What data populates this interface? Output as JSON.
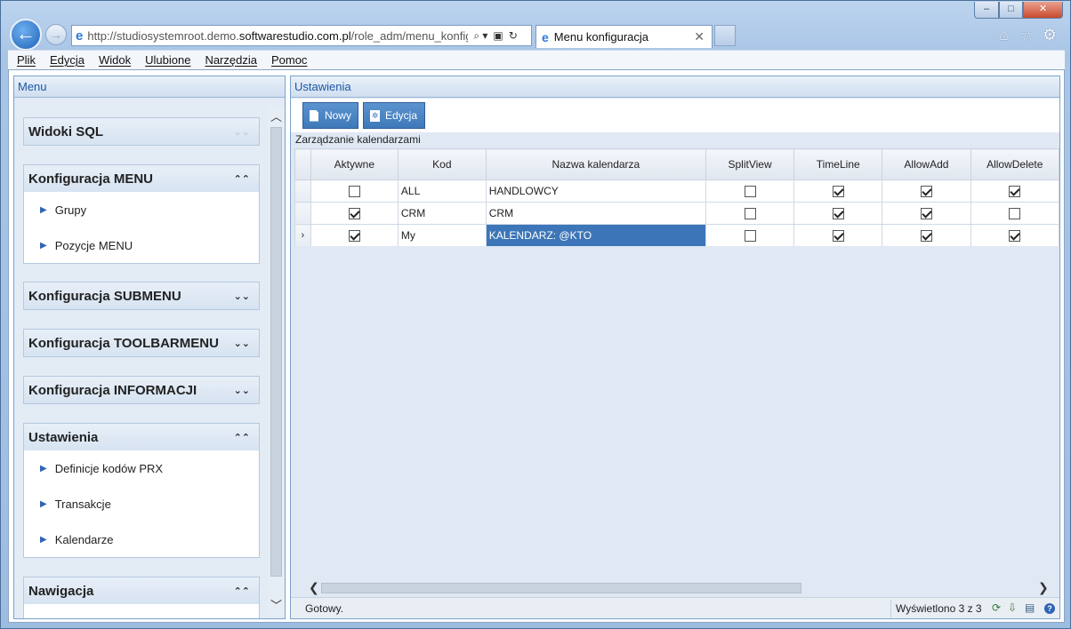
{
  "browser": {
    "address": "http://studiosystemroot.demo.softwarestudio.com.pl/role_adm/menu_konfigur",
    "address_prefix": "http://studiosystemroot.demo.",
    "address_domain": "softwarestudio.com.pl",
    "address_suffix": "/role_adm/menu_konfigur",
    "tab_title": "Menu konfiguracja",
    "menu": [
      "Plik",
      "Edycja",
      "Widok",
      "Ulubione",
      "Narzędzia",
      "Pomoc"
    ]
  },
  "left": {
    "header": "Menu",
    "sections": [
      {
        "title": "Widoki SQL",
        "expanded": false,
        "items": []
      },
      {
        "title": "Konfiguracja MENU",
        "expanded": true,
        "items": [
          "Grupy",
          "Pozycje MENU"
        ]
      },
      {
        "title": "Konfiguracja SUBMENU",
        "expanded": false,
        "items": []
      },
      {
        "title": "Konfiguracja TOOLBARMENU",
        "expanded": false,
        "items": []
      },
      {
        "title": "Konfiguracja INFORMACJI",
        "expanded": false,
        "items": []
      },
      {
        "title": "Ustawienia",
        "expanded": true,
        "items": [
          "Definicje kodów PRX",
          "Transakcje",
          "Kalendarze"
        ]
      },
      {
        "title": "Nawigacja",
        "expanded": true,
        "items": []
      }
    ]
  },
  "right": {
    "header": "Ustawienia",
    "toolbar": {
      "new_label": "Nowy",
      "edit_label": "Edycja"
    },
    "section_title": "Zarządzanie kalendarzami",
    "columns": [
      "Aktywne",
      "Kod",
      "Nazwa kalendarza",
      "SplitView",
      "TimeLine",
      "AllowAdd",
      "AllowDelete"
    ],
    "rows": [
      {
        "aktywne": false,
        "kod": "ALL",
        "nazwa": "HANDLOWCY",
        "splitview": false,
        "timeline": true,
        "allowadd": true,
        "allowdelete": true
      },
      {
        "aktywne": true,
        "kod": "CRM",
        "nazwa": "CRM",
        "splitview": false,
        "timeline": true,
        "allowadd": true,
        "allowdelete": false
      },
      {
        "aktywne": true,
        "kod": "My",
        "nazwa": "KALENDARZ: @KTO",
        "splitview": false,
        "timeline": true,
        "allowadd": true,
        "allowdelete": true,
        "current": true
      }
    ],
    "status": "Gotowy.",
    "count": "Wyświetlono 3 z 3"
  },
  "colors": {
    "accent": "#3d76b8",
    "header_text": "#1b57a6",
    "panel_bg": "#dfe8f3"
  }
}
